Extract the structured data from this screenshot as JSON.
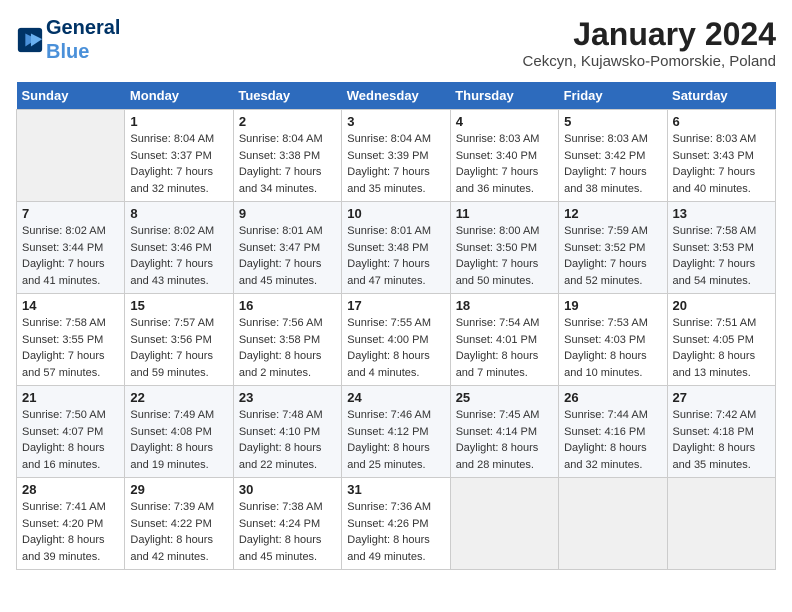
{
  "header": {
    "logo_line1": "General",
    "logo_line2": "Blue",
    "month": "January 2024",
    "location": "Cekcyn, Kujawsko-Pomorskie, Poland"
  },
  "weekdays": [
    "Sunday",
    "Monday",
    "Tuesday",
    "Wednesday",
    "Thursday",
    "Friday",
    "Saturday"
  ],
  "weeks": [
    [
      {
        "day": "",
        "info": ""
      },
      {
        "day": "1",
        "info": "Sunrise: 8:04 AM\nSunset: 3:37 PM\nDaylight: 7 hours\nand 32 minutes."
      },
      {
        "day": "2",
        "info": "Sunrise: 8:04 AM\nSunset: 3:38 PM\nDaylight: 7 hours\nand 34 minutes."
      },
      {
        "day": "3",
        "info": "Sunrise: 8:04 AM\nSunset: 3:39 PM\nDaylight: 7 hours\nand 35 minutes."
      },
      {
        "day": "4",
        "info": "Sunrise: 8:03 AM\nSunset: 3:40 PM\nDaylight: 7 hours\nand 36 minutes."
      },
      {
        "day": "5",
        "info": "Sunrise: 8:03 AM\nSunset: 3:42 PM\nDaylight: 7 hours\nand 38 minutes."
      },
      {
        "day": "6",
        "info": "Sunrise: 8:03 AM\nSunset: 3:43 PM\nDaylight: 7 hours\nand 40 minutes."
      }
    ],
    [
      {
        "day": "7",
        "info": "Sunrise: 8:02 AM\nSunset: 3:44 PM\nDaylight: 7 hours\nand 41 minutes."
      },
      {
        "day": "8",
        "info": "Sunrise: 8:02 AM\nSunset: 3:46 PM\nDaylight: 7 hours\nand 43 minutes."
      },
      {
        "day": "9",
        "info": "Sunrise: 8:01 AM\nSunset: 3:47 PM\nDaylight: 7 hours\nand 45 minutes."
      },
      {
        "day": "10",
        "info": "Sunrise: 8:01 AM\nSunset: 3:48 PM\nDaylight: 7 hours\nand 47 minutes."
      },
      {
        "day": "11",
        "info": "Sunrise: 8:00 AM\nSunset: 3:50 PM\nDaylight: 7 hours\nand 50 minutes."
      },
      {
        "day": "12",
        "info": "Sunrise: 7:59 AM\nSunset: 3:52 PM\nDaylight: 7 hours\nand 52 minutes."
      },
      {
        "day": "13",
        "info": "Sunrise: 7:58 AM\nSunset: 3:53 PM\nDaylight: 7 hours\nand 54 minutes."
      }
    ],
    [
      {
        "day": "14",
        "info": "Sunrise: 7:58 AM\nSunset: 3:55 PM\nDaylight: 7 hours\nand 57 minutes."
      },
      {
        "day": "15",
        "info": "Sunrise: 7:57 AM\nSunset: 3:56 PM\nDaylight: 7 hours\nand 59 minutes."
      },
      {
        "day": "16",
        "info": "Sunrise: 7:56 AM\nSunset: 3:58 PM\nDaylight: 8 hours\nand 2 minutes."
      },
      {
        "day": "17",
        "info": "Sunrise: 7:55 AM\nSunset: 4:00 PM\nDaylight: 8 hours\nand 4 minutes."
      },
      {
        "day": "18",
        "info": "Sunrise: 7:54 AM\nSunset: 4:01 PM\nDaylight: 8 hours\nand 7 minutes."
      },
      {
        "day": "19",
        "info": "Sunrise: 7:53 AM\nSunset: 4:03 PM\nDaylight: 8 hours\nand 10 minutes."
      },
      {
        "day": "20",
        "info": "Sunrise: 7:51 AM\nSunset: 4:05 PM\nDaylight: 8 hours\nand 13 minutes."
      }
    ],
    [
      {
        "day": "21",
        "info": "Sunrise: 7:50 AM\nSunset: 4:07 PM\nDaylight: 8 hours\nand 16 minutes."
      },
      {
        "day": "22",
        "info": "Sunrise: 7:49 AM\nSunset: 4:08 PM\nDaylight: 8 hours\nand 19 minutes."
      },
      {
        "day": "23",
        "info": "Sunrise: 7:48 AM\nSunset: 4:10 PM\nDaylight: 8 hours\nand 22 minutes."
      },
      {
        "day": "24",
        "info": "Sunrise: 7:46 AM\nSunset: 4:12 PM\nDaylight: 8 hours\nand 25 minutes."
      },
      {
        "day": "25",
        "info": "Sunrise: 7:45 AM\nSunset: 4:14 PM\nDaylight: 8 hours\nand 28 minutes."
      },
      {
        "day": "26",
        "info": "Sunrise: 7:44 AM\nSunset: 4:16 PM\nDaylight: 8 hours\nand 32 minutes."
      },
      {
        "day": "27",
        "info": "Sunrise: 7:42 AM\nSunset: 4:18 PM\nDaylight: 8 hours\nand 35 minutes."
      }
    ],
    [
      {
        "day": "28",
        "info": "Sunrise: 7:41 AM\nSunset: 4:20 PM\nDaylight: 8 hours\nand 39 minutes."
      },
      {
        "day": "29",
        "info": "Sunrise: 7:39 AM\nSunset: 4:22 PM\nDaylight: 8 hours\nand 42 minutes."
      },
      {
        "day": "30",
        "info": "Sunrise: 7:38 AM\nSunset: 4:24 PM\nDaylight: 8 hours\nand 45 minutes."
      },
      {
        "day": "31",
        "info": "Sunrise: 7:36 AM\nSunset: 4:26 PM\nDaylight: 8 hours\nand 49 minutes."
      },
      {
        "day": "",
        "info": ""
      },
      {
        "day": "",
        "info": ""
      },
      {
        "day": "",
        "info": ""
      }
    ]
  ]
}
